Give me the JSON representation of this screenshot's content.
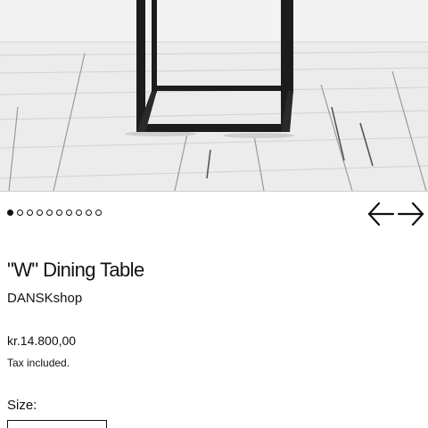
{
  "product": {
    "image": {
      "alt_subject": "black metal frame table leg on white wooden floor",
      "slide_count": 10,
      "active_slide": 1
    },
    "title": "\"W\" Dining Table",
    "vendor": "DANSKshop",
    "price": "kr.14.800,00",
    "tax_note": "Tax included.",
    "size_label": "Size:",
    "size_value": ""
  },
  "navigation": {
    "prev_icon": "arrow-left-icon",
    "next_icon": "arrow-right-icon"
  },
  "colors": {
    "text": "#111111",
    "background": "#ffffff",
    "frame": "#1c1c1c",
    "floor": "#eeeeee"
  }
}
